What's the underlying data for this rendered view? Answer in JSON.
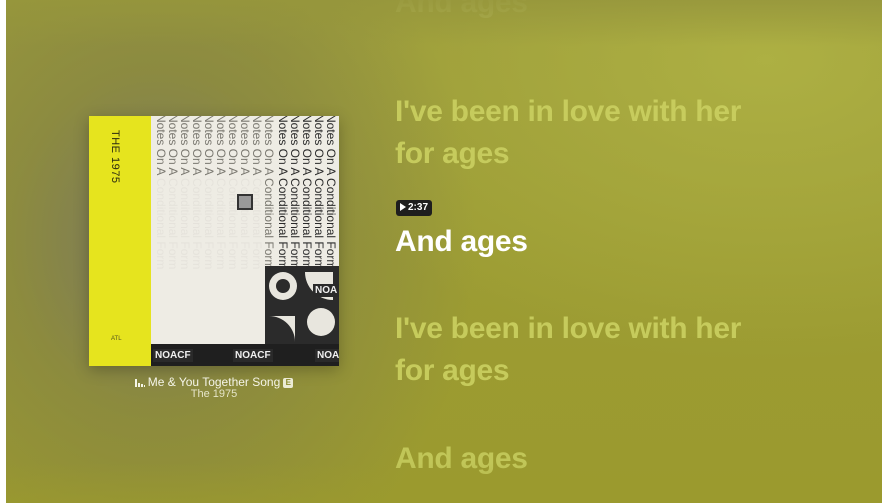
{
  "album_art": {
    "band_text": "THE 1975",
    "repeated_title": "Notes On A Conditional Form",
    "bottom_labels": [
      "NOACF",
      "NOACF",
      "NOA"
    ],
    "side_label": "NOA"
  },
  "now_playing": {
    "song_title": "Me & You Together Song",
    "explicit_badge": "E",
    "artist": "The 1975"
  },
  "lyrics": {
    "lines": [
      {
        "text": "And ages",
        "state": "past"
      },
      {
        "text": "I've been in love with her",
        "state": "past"
      },
      {
        "text": "for ages",
        "state": "past"
      },
      {
        "text": "And ages",
        "state": "current"
      },
      {
        "text": "I've been in love with her",
        "state": "upcoming"
      },
      {
        "text": "for ages",
        "state": "upcoming"
      },
      {
        "text": "And ages",
        "state": "upcoming"
      }
    ],
    "timestamp": "2:37"
  },
  "colors": {
    "background": "#9b9a30",
    "lyric_inactive": "#c8ce5f",
    "lyric_active": "#ffffff",
    "album_yellow": "#e6e41e"
  }
}
